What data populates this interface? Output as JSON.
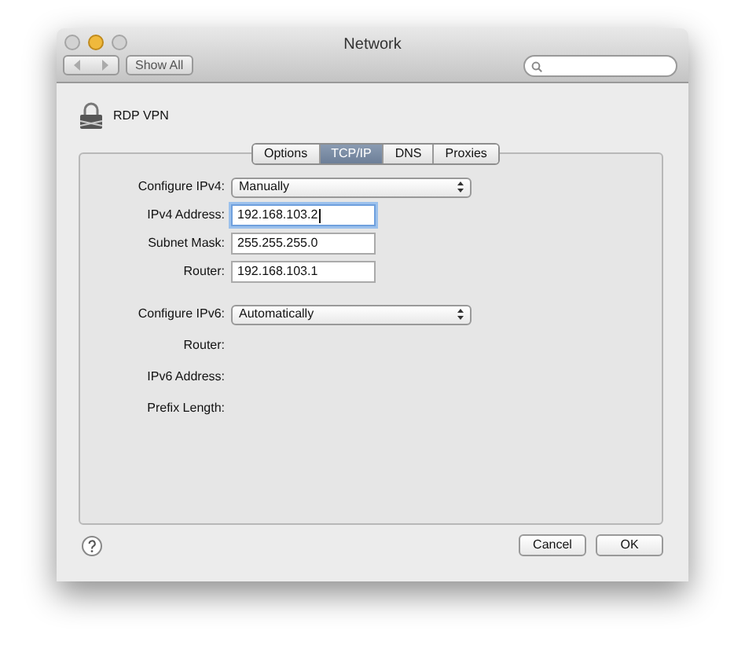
{
  "window": {
    "title": "Network"
  },
  "toolbar": {
    "show_all": "Show All"
  },
  "service": {
    "name": "RDP VPN"
  },
  "tabs": [
    {
      "label": "Options",
      "selected": false
    },
    {
      "label": "TCP/IP",
      "selected": true
    },
    {
      "label": "DNS",
      "selected": false
    },
    {
      "label": "Proxies",
      "selected": false
    }
  ],
  "rows": [
    {
      "kind": "popup",
      "label": "Configure IPv4:",
      "value": "Manually"
    },
    {
      "kind": "field",
      "label": "IPv4 Address:",
      "value": "192.168.103.2",
      "focused": true
    },
    {
      "kind": "field",
      "label": "Subnet Mask:",
      "value": "255.255.255.0",
      "focused": false
    },
    {
      "kind": "field",
      "label": "Router:",
      "value": "192.168.103.1",
      "focused": false
    },
    {
      "kind": "popup",
      "label": "Configure IPv6:",
      "value": "Automatically"
    },
    {
      "kind": "label",
      "label": "Router:"
    },
    {
      "kind": "label",
      "label": "IPv6 Address:"
    },
    {
      "kind": "label",
      "label": "Prefix Length:"
    }
  ],
  "buttons": [
    {
      "label": "Cancel",
      "default": false
    },
    {
      "label": "OK",
      "default": false
    }
  ]
}
